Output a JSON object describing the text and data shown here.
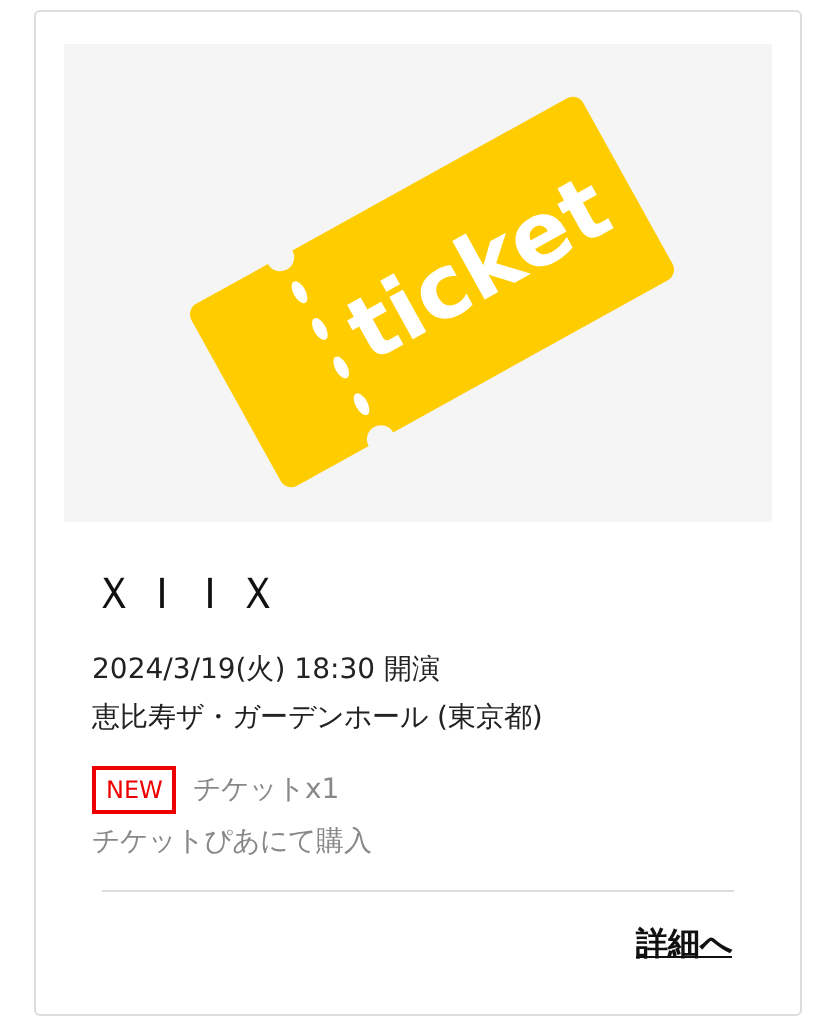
{
  "card": {
    "image": {
      "text": "ticket"
    },
    "title": "ＸＩＩＸ",
    "date": "2024/3/19(火) 18:30 開演",
    "venue": "恵比寿ザ・ガーデンホール (東京都)",
    "badge": "NEW",
    "tickets": "チケットx1",
    "source": "チケットぴあにて購入",
    "link": "詳細へ"
  }
}
